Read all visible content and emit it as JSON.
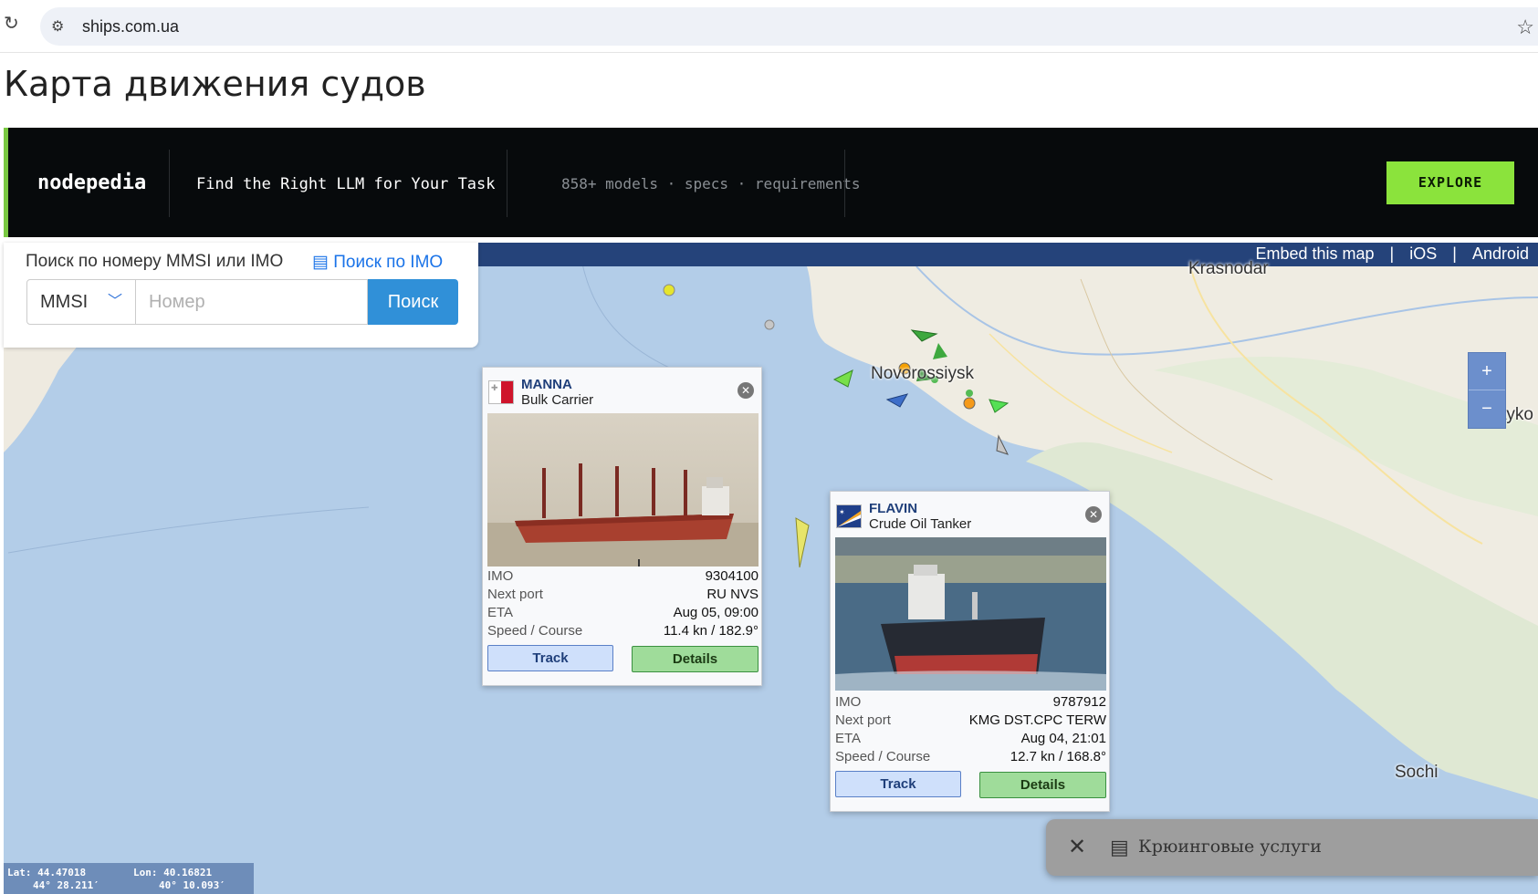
{
  "browser": {
    "url": "ships.com.ua"
  },
  "page": {
    "title": "Карта движения судов"
  },
  "ad": {
    "logo": "nodepedia",
    "headline": "Find the Right LLM for Your Task",
    "subline": "858+ models · specs · requirements",
    "cta": "EXPLORE"
  },
  "map": {
    "links": [
      "Embed this map",
      "|",
      "iOS",
      "|",
      "Android"
    ],
    "zoom_in": "+",
    "zoom_out": "−",
    "labels": {
      "novorossiysk": "Novorossiysk",
      "krasnodar": "Krasnodar",
      "maykop": "Mayko",
      "sochi": "Sochi"
    },
    "colors": {
      "sea": "#b3cde8",
      "land": "#f2efe6",
      "bar": "#25437a"
    }
  },
  "search": {
    "label": "Поиск по номеру MMSI или IMO",
    "imo_link": "Поиск по IMO",
    "select_value": "MMSI",
    "input_placeholder": "Номер",
    "button": "Поиск"
  },
  "ships": [
    {
      "name": "MANNA",
      "type": "Bulk Carrier",
      "imo_label": "IMO",
      "imo": "9304100",
      "port_label": "Next port",
      "port": "RU NVS",
      "eta_label": "ETA",
      "eta": "Aug 05, 09:00",
      "speed_label": "Speed / Course",
      "speed": "11.4 kn / 182.9°",
      "track": "Track",
      "details": "Details"
    },
    {
      "name": "FLAVIN",
      "type": "Crude Oil Tanker",
      "imo_label": "IMO",
      "imo": "9787912",
      "port_label": "Next port",
      "port": "KMG DST.CPC TERW",
      "eta_label": "ETA",
      "eta": "Aug 04, 21:01",
      "speed_label": "Speed / Course",
      "speed": "12.7 kn / 168.8°",
      "track": "Track",
      "details": "Details"
    }
  ],
  "coords": {
    "lat_label": "Lat: 44.47018",
    "lat_dm": "44° 28.211′",
    "lon_label": "Lon: 40.16821",
    "lon_dm": "40° 10.093′"
  },
  "toast": {
    "close": "✕",
    "text": "Крюинговые услуги"
  }
}
